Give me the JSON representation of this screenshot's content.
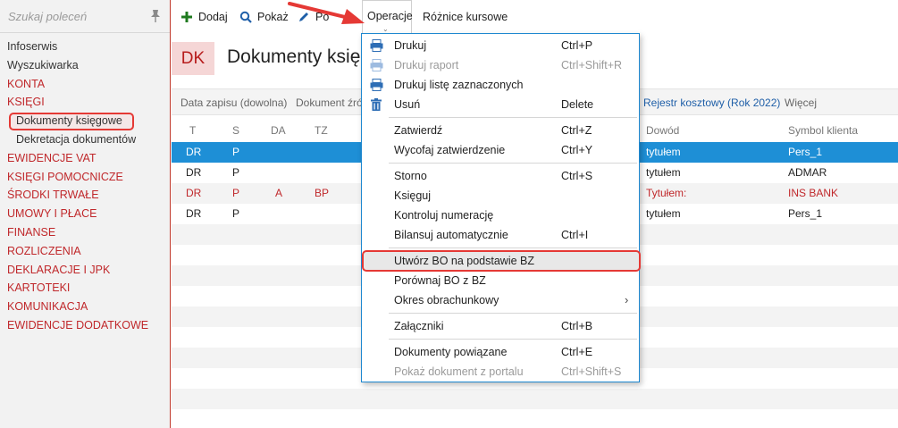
{
  "sidebar": {
    "search_placeholder": "Szukaj poleceń",
    "items": [
      {
        "label": "Infoserwis",
        "style": "plain"
      },
      {
        "label": "Wyszukiwarka",
        "style": "plain"
      },
      {
        "label": "KONTA",
        "style": "red"
      },
      {
        "label": "KSIĘGI",
        "style": "red"
      },
      {
        "label": "Dokumenty księgowe",
        "style": "sub-active"
      },
      {
        "label": "Dekretacja dokumentów",
        "style": "sub"
      },
      {
        "label": "EWIDENCJE VAT",
        "style": "red"
      },
      {
        "label": "KSIĘGI POMOCNICZE",
        "style": "red"
      },
      {
        "label": "ŚRODKI TRWAŁE",
        "style": "red"
      },
      {
        "label": "UMOWY I PŁACE",
        "style": "red"
      },
      {
        "label": "FINANSE",
        "style": "red"
      },
      {
        "label": "ROZLICZENIA",
        "style": "red"
      },
      {
        "label": "DEKLARACJE I JPK",
        "style": "red"
      },
      {
        "label": "KARTOTEKI",
        "style": "red"
      },
      {
        "label": "KOMUNIKACJA",
        "style": "red"
      },
      {
        "label": "EWIDENCJE DODATKOWE",
        "style": "red"
      }
    ]
  },
  "toolbar": {
    "add_label": "Dodaj",
    "show_label": "Pokaż",
    "edit_label": "Po",
    "operations_label": "Operacje",
    "exchange_label": "Różnice kursowe"
  },
  "header": {
    "badge": "DK",
    "title": "Dokumenty księg"
  },
  "filters": {
    "date": "Data zapisu (dowolna)",
    "source": "Dokument źró",
    "register": "Rejestr kosztowy (Rok 2022)",
    "more": "Więcej"
  },
  "table": {
    "columns": {
      "t": "T",
      "s": "S",
      "da": "DA",
      "tz": "TZ",
      "reason": "Dowód",
      "client": "Symbol klienta"
    },
    "rows": [
      {
        "t": "DR",
        "s": "P",
        "da": "",
        "tz": "",
        "reason": "tytułem",
        "client": "Pers_1",
        "state": "selected"
      },
      {
        "t": "DR",
        "s": "P",
        "da": "",
        "tz": "",
        "reason": "tytułem",
        "client": "ADMAR",
        "state": "normal"
      },
      {
        "t": "DR",
        "s": "P",
        "da": "A",
        "tz": "BP",
        "reason": "Tytułem:",
        "client": "INS BANK",
        "state": "error"
      },
      {
        "t": "DR",
        "s": "P",
        "da": "",
        "tz": "",
        "reason": "tytułem",
        "client": "Pers_1",
        "state": "normal"
      }
    ]
  },
  "menu": {
    "items": [
      {
        "label": "Drukuj",
        "shortcut": "Ctrl+P",
        "icon": "printer-icon",
        "disabled": false
      },
      {
        "label": "Drukuj raport",
        "shortcut": "Ctrl+Shift+R",
        "icon": "printer-icon",
        "disabled": true
      },
      {
        "label": "Drukuj listę zaznaczonych",
        "shortcut": "",
        "icon": "printer-icon",
        "disabled": false
      },
      {
        "label": "Usuń",
        "shortcut": "Delete",
        "icon": "trash-icon",
        "disabled": false
      },
      {
        "label": "Zatwierdź",
        "shortcut": "Ctrl+Z",
        "disabled": false
      },
      {
        "label": "Wycofaj zatwierdzenie",
        "shortcut": "Ctrl+Y",
        "disabled": false
      },
      {
        "label": "Storno",
        "shortcut": "Ctrl+S",
        "disabled": false
      },
      {
        "label": "Księguj",
        "shortcut": "",
        "disabled": false
      },
      {
        "label": "Kontroluj numerację",
        "shortcut": "",
        "disabled": false
      },
      {
        "label": "Bilansuj automatycznie",
        "shortcut": "Ctrl+I",
        "disabled": false
      },
      {
        "label": "Utwórz BO na podstawie BZ",
        "shortcut": "",
        "disabled": false,
        "highlighted": true
      },
      {
        "label": "Porównaj BO z BZ",
        "shortcut": "",
        "disabled": false
      },
      {
        "label": "Okres obrachunkowy",
        "shortcut": "",
        "disabled": false,
        "submenu": "›"
      },
      {
        "label": "Załączniki",
        "shortcut": "Ctrl+B",
        "disabled": false
      },
      {
        "label": "Dokumenty powiązane",
        "shortcut": "Ctrl+E",
        "disabled": false
      },
      {
        "label": "Pokaż dokument z portalu",
        "shortcut": "Ctrl+Shift+S",
        "disabled": true
      }
    ]
  },
  "colors": {
    "brand_red": "#c0282b",
    "highlight_outline": "#e53935",
    "selection_blue": "#1e8fd6"
  }
}
